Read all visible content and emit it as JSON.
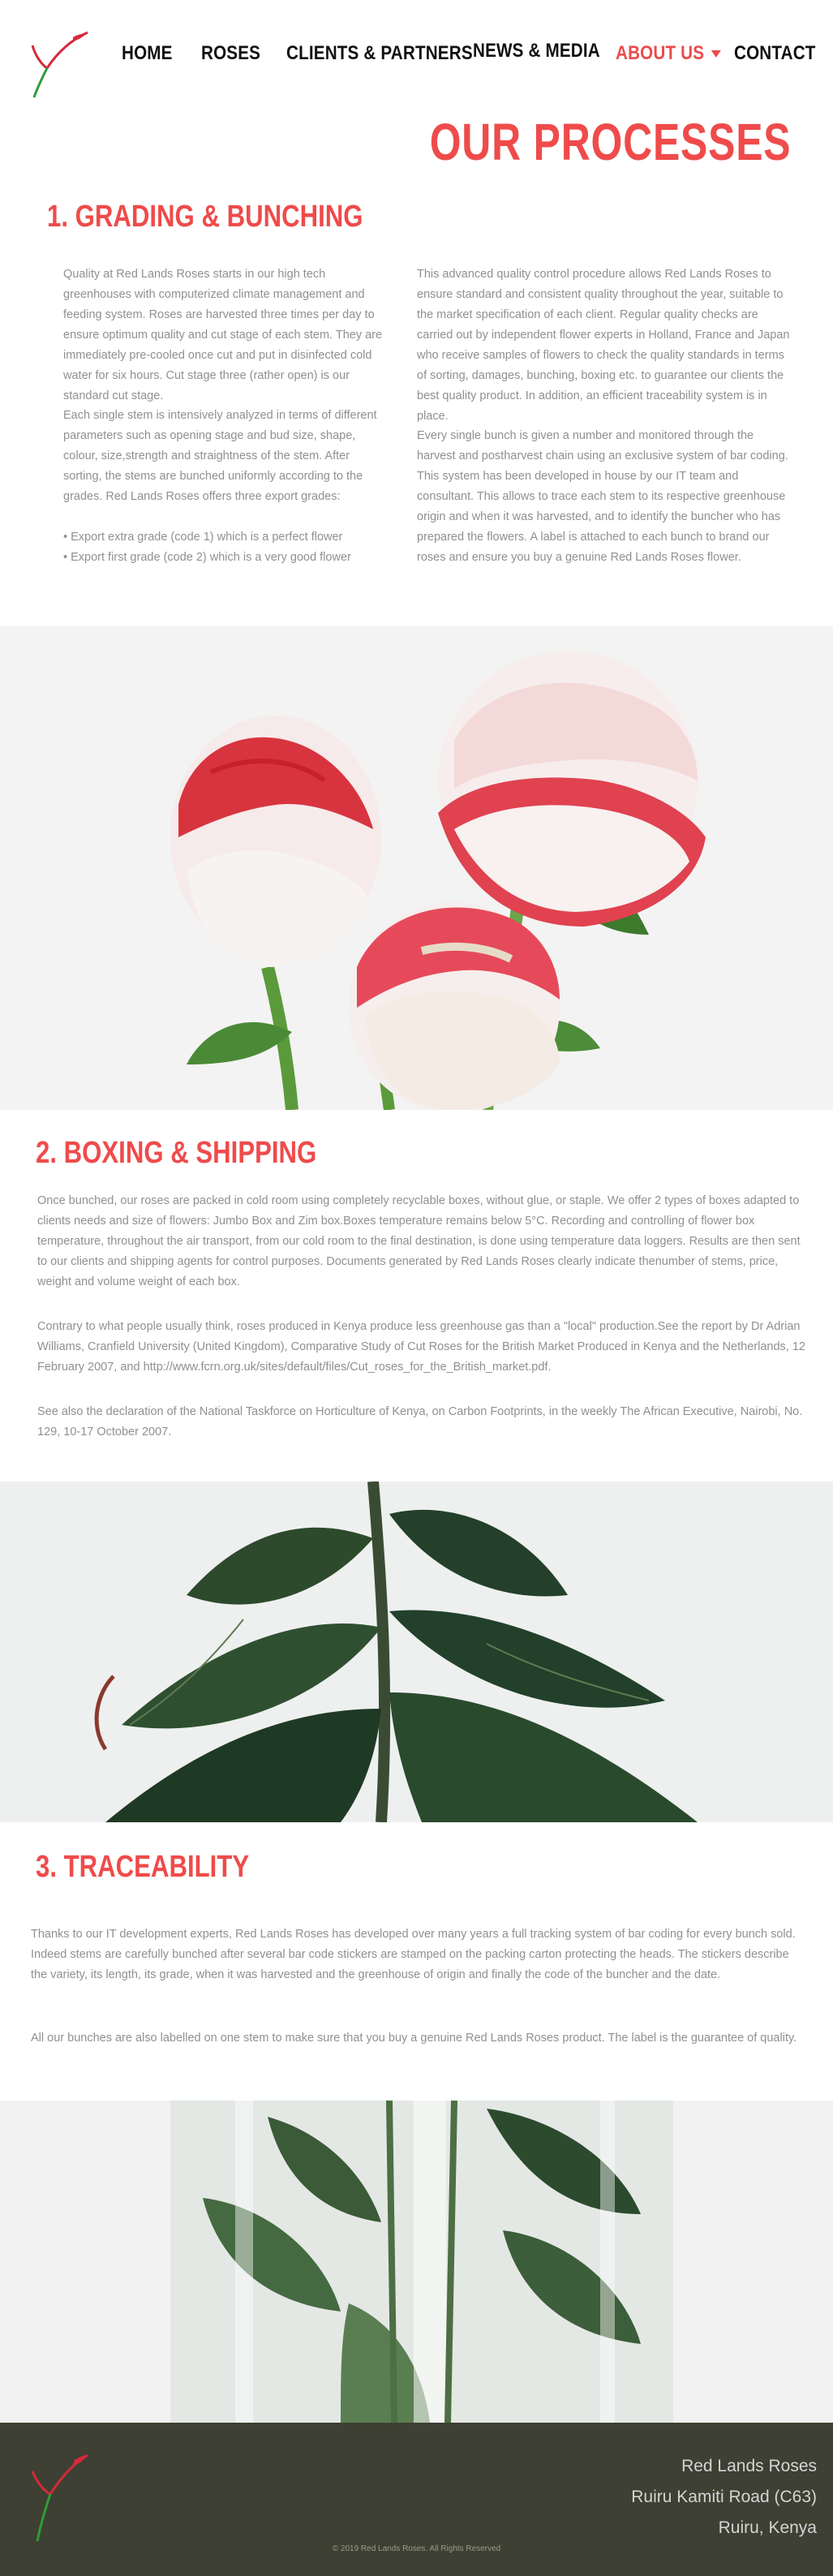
{
  "nav": {
    "home": "HOME",
    "roses": "ROSES",
    "clients": "CLIENTS & PARTNERS",
    "news": "NEWS & MEDIA",
    "about": "ABOUT US",
    "contact": "CONTACT"
  },
  "page_title": "OUR PROCESSES",
  "sections": {
    "grading": {
      "heading": "1. GRADING & BUNCHING",
      "left_p1": "Quality at Red Lands Roses starts in our high tech greenhouses with computerized climate management and feeding system. Roses are harvested three times per day to ensure optimum quality and cut stage of each stem. They are immediately pre-cooled once cut and put in disinfected cold water for six hours. Cut stage three (rather open) is our standard cut stage.",
      "left_p2": "Each single stem is intensively analyzed in terms of different parameters such as opening stage and bud size, shape, colour, size,strength and straightness of the stem. After sorting, the stems are bunched uniformly according to the grades. Red Lands Roses offers three export grades:",
      "bullets": [
        "Export extra grade (code 1) which is a perfect flower",
        "Export first grade (code 2) which is a very good flower"
      ],
      "right_p1": "This advanced quality control procedure allows Red Lands Roses to ensure standard and consistent quality throughout the year, suitable to the market specification of each client. Regular quality checks are carried out by independent flower experts in Holland, France and Japan who receive samples of flowers to check the quality standards in terms of sorting, damages, bunching, boxing etc. to guarantee our clients the best quality product. In addition, an efficient traceability system is in place.",
      "right_p2": "Every single bunch is given a number and monitored through the harvest and postharvest chain using an exclusive system of bar coding. This system has been developed in house by our IT team and consultant. This allows to trace each stem to its respective greenhouse origin and when it was harvested, and to identify the buncher who has prepared the flowers. A label is attached to each bunch to brand our roses and ensure you buy a genuine Red Lands Roses flower."
    },
    "boxing": {
      "heading": "2. BOXING & SHIPPING",
      "p1": "Once bunched, our roses are packed in cold room using completely recyclable boxes, without glue, or staple. We offer 2 types of boxes adapted to clients needs and size of flowers: Jumbo Box and Zim box.Boxes temperature remains below 5°C. Recording and controlling of flower box temperature, throughout the air transport, from our cold room to the final destination, is done using temperature data loggers. Results are then sent to our clients and shipping agents for control purposes. Documents generated by Red Lands Roses clearly indicate thenumber of stems, price, weight and volume weight of each box.",
      "p2": "Contrary to what people usually think, roses produced in Kenya produce less greenhouse gas than a \"local\" production.See the report by Dr Adrian Williams, Cranfield University (United Kingdom), Comparative Study of Cut Roses for the British Market Produced in Kenya and the Netherlands, 12 February 2007, and http://www.fcrn.org.uk/sites/default/files/Cut_roses_for_the_British_market.pdf.",
      "p3": "See also the declaration of the National Taskforce on Horticulture of Kenya, on Carbon Footprints, in the weekly The African Executive, Nairobi, No. 129, 10-17 October 2007."
    },
    "traceability": {
      "heading": "3. TRACEABILITY",
      "p1": "Thanks to our IT development experts, Red Lands Roses has developed over many years a full tracking system of bar coding for every bunch sold. Indeed stems are carefully bunched after several bar code stickers are stamped on the packing carton protecting the heads. The stickers describe the variety, its length, its grade, when it was harvested and the greenhouse of origin and finally the code of the buncher and the date.",
      "p2": "All our bunches are also labelled on one stem to make sure that you buy a genuine Red Lands Roses product. The label is the guarantee of quality."
    }
  },
  "footer": {
    "company": "Red Lands Roses",
    "road": "Ruiru Kamiti Road (C63)",
    "town": "Ruiru, Kenya",
    "copyright": "© 2019 Red Lands Roses. All Rights Reserved"
  },
  "colors": {
    "accent": "#ef4b4b",
    "body_text": "#909090",
    "footer_bg": "#3d4032"
  }
}
